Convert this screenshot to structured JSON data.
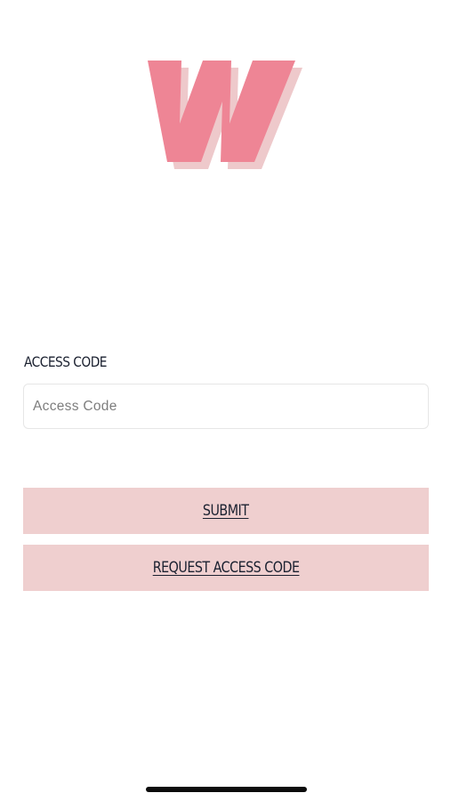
{
  "logo": {
    "letter": "W",
    "icon": "w-logo-icon",
    "colors": {
      "front": "#ee8595",
      "shadow": "#eec9cb"
    }
  },
  "form": {
    "label": "ACCESS CODE",
    "input": {
      "placeholder": "Access Code",
      "value": ""
    },
    "submit_label": "SUBMIT",
    "request_label": "REQUEST ACCESS CODE"
  },
  "colors": {
    "button_bg": "#efcfcf",
    "text": "#1b2130"
  }
}
